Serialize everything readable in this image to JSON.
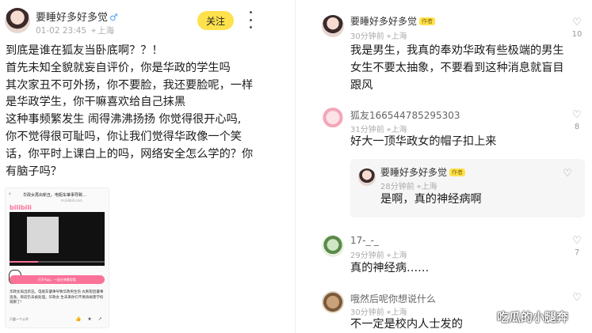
{
  "post": {
    "username": "要睡好多好多觉",
    "gender_icon": "male-icon",
    "date": "01-02 23:45",
    "location": "上海",
    "follow_label": "关注",
    "lines": [
      "到底是谁在狐友当卧底啊？？！",
      "首先未知全貌就妄自评价，你是华政的学生吗",
      "其次家丑不可外扬，你不要脸，我还要脸呢，一样",
      "是华政学生，你干嘛喜欢给自己抹黑",
      "这种事频繁发生 闹得沸沸扬扬 你觉得很开心吗,",
      "你不觉得很可耻吗，你让我们觉得华政像一个笑",
      "话，你平时上课白上的吗，网络安全怎么学的？你",
      "有脑子吗？"
    ],
    "embed": {
      "title": "华政女再出新丑。电瓶车肇事导致…",
      "url": "m.bilibili.com",
      "brand": "bilibili",
      "bar_label": "打开App，一起在弹幕里看",
      "text": "华政女再出新丑。电瓶车肇事导致华政男生伤 丸断裂后肇事逃逸，目前仍未被处理。华政女 生未来你们不要再祸害学校观察了!",
      "footer": "只要一个公平"
    }
  },
  "comments": [
    {
      "user": "要睡好多好多觉",
      "badge": "作者",
      "time": "30分钟前",
      "location": "上海",
      "text_lines": [
        "我是男生，我真的奉劝华政有些极端的男生",
        "女生不要太抽象，不要看到这种消息就盲目",
        "跟风"
      ],
      "likes": "10"
    },
    {
      "user": "狐友166544785295303",
      "badge": "",
      "time": "31分钟前",
      "location": "上海",
      "text_lines": [
        "好大一顶华政女的帽子扣上来"
      ],
      "likes": "8"
    },
    {
      "user": "17-_-_",
      "badge": "",
      "time": "29分钟前",
      "location": "上海",
      "text_lines": [
        "真的神经病……"
      ],
      "likes": "7"
    },
    {
      "user": "哦然后呢你想说什么",
      "badge": "",
      "time": "30分钟前",
      "location": "上海",
      "text_lines": [
        "不一定是校内人士发的"
      ],
      "likes": ""
    }
  ],
  "reply": {
    "user": "要睡好多好多觉",
    "badge": "作者",
    "time": "28分钟前",
    "location": "上海",
    "text": "是啊，真的神经病啊"
  },
  "watermark": "吃瓜的小腿奔",
  "colors": {
    "follow": "#ffe14d",
    "badge": "#ffe14d",
    "meta": "#aaaaaa",
    "bilibili": "#fb7299"
  }
}
